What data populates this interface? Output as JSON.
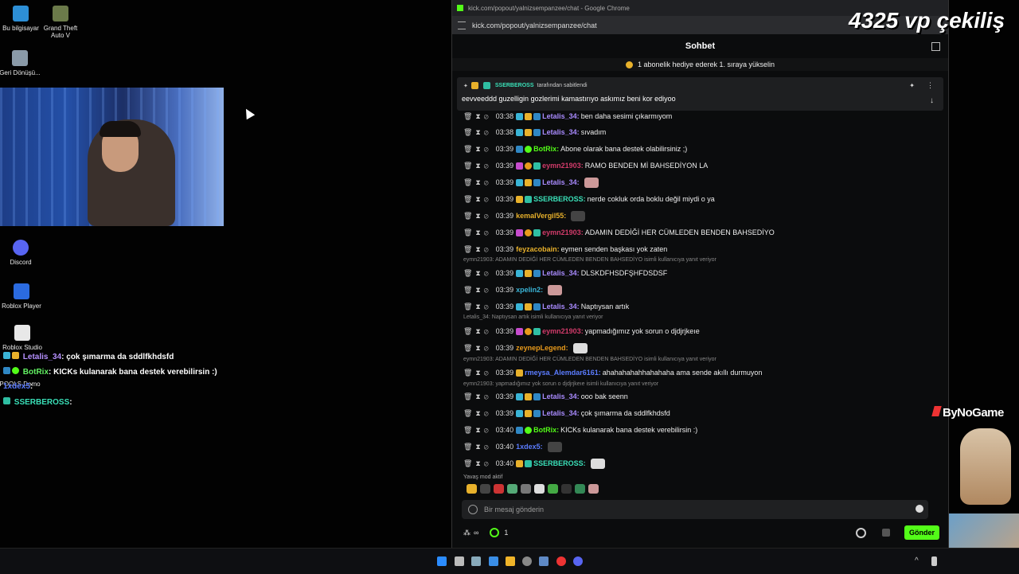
{
  "desktop": {
    "icons": [
      {
        "label": "Bu bilgisayar"
      },
      {
        "label": "Grand Theft Auto V"
      },
      {
        "label": "Geri Dönüşü..."
      },
      {
        "label": "Discord"
      },
      {
        "label": "Roblox Player"
      },
      {
        "label": "Roblox Studio"
      },
      {
        "label": "POOLS Demo"
      }
    ],
    "overlay_chat": [
      {
        "user": "Letalis_34",
        "text": ": çok şımarma da sddlfkhdsfd"
      },
      {
        "user": "BotRix",
        "text": ": KICKs kulanarak bana destek verebilirsin :)"
      },
      {
        "user": "1xdex5",
        "text": ":"
      },
      {
        "user": "SSERBEROSS",
        "text": ":"
      }
    ]
  },
  "browser": {
    "title": "kick.com/popout/yalnizsempanzee/chat - Google Chrome",
    "url": "kick.com/popout/yalnizsempanzee/chat"
  },
  "chat": {
    "header": "Sohbet",
    "banner": "1 abonelik hediye ederek 1. sıraya yükselin",
    "pinned": {
      "by_user": "SSERBEROSS",
      "by_suffix": "tarafından sabitlendi",
      "text": "eevveeddd guzelligin gozlerimi kamastırıyo askımız beni kor ediyoo"
    },
    "messages": [
      {
        "time": "03:38",
        "user": "Letalis_34",
        "text": "ben daha sesimi çıkarmıyom",
        "color": "#a98bff"
      },
      {
        "time": "03:38",
        "user": "Letalis_34",
        "text": "sıvadım",
        "color": "#a98bff"
      },
      {
        "time": "03:39",
        "user": "BotRix",
        "text": "Abone olarak bana destek olabilirsiniz ;)",
        "color": "#53fc18"
      },
      {
        "time": "03:39",
        "user": "eymn21903",
        "text": "RAMO BENDEN Mİ BAHSEDİYON LA",
        "color": "#d13b6a"
      },
      {
        "time": "03:39",
        "user": "Letalis_34",
        "text": "",
        "color": "#a98bff"
      },
      {
        "time": "03:39",
        "user": "SSERBEROSS",
        "text": "nerde cokluk orda boklu değil miydi o ya",
        "color": "#3ae0b8"
      },
      {
        "time": "03:39",
        "user": "kemalVergil55",
        "text": "",
        "color": "#e8b12b"
      },
      {
        "time": "03:39",
        "user": "eymn21903",
        "text": "ADAMIN DEDİĞİ HER CÜMLEDEN BENDEN BAHSEDİYO",
        "color": "#d13b6a"
      },
      {
        "time": "03:39",
        "user": "feyzacobain",
        "text": "eymen senden başkası yok zaten",
        "color": "#e8b12b"
      },
      {
        "time": "03:39",
        "user": "Letalis_34",
        "text": "DLSKDFHSDFŞHFDSDSF",
        "color": "#a98bff"
      },
      {
        "time": "03:39",
        "user": "xpelin2",
        "text": "",
        "color": "#3ab4d6"
      },
      {
        "time": "03:39",
        "user": "Letalis_34",
        "text": "Naptıysan artık",
        "color": "#a98bff"
      },
      {
        "time": "03:39",
        "user": "eymn21903",
        "text": "yapmadığımız yok sorun o djdjrjkeıe",
        "color": "#d13b6a"
      },
      {
        "time": "03:39",
        "user": "zeynepLegend",
        "text": "",
        "color": "#e89a1b"
      },
      {
        "time": "03:39",
        "user": "rmeysa_Alemdar6161",
        "text": "ahahahahahhahahaha ama sende akıllı durmuyon",
        "color": "#5b7cff"
      },
      {
        "time": "03:39",
        "user": "Letalis_34",
        "text": "ooo bak seenn",
        "color": "#a98bff"
      },
      {
        "time": "03:39",
        "user": "Letalis_34",
        "text": "çok şımarma da sddlfkhdsfd",
        "color": "#a98bff"
      },
      {
        "time": "03:40",
        "user": "BotRix",
        "text": "KICKs kulanarak bana destek verebilirsin :)",
        "color": "#53fc18"
      },
      {
        "time": "03:40",
        "user": "1xdex5",
        "text": "",
        "color": "#5b7cff"
      },
      {
        "time": "03:40",
        "user": "SSERBEROSS",
        "text": "",
        "color": "#3ae0b8"
      }
    ],
    "replies": [
      "eymn21903: ADAMIN DEDİĞİ HER CÜMLEDEN BENDEN BAHSEDİYO isimli kullanıcıya yanıt veriyor",
      "Letalis_34: Naptıysan artık isimli kullanıcıya yanıt veriyor",
      "eymn21903: ADAMIN DEDİĞİ HER CÜMLEDEN BENDEN BAHSEDİYO isimli kullanıcıya yanıt veriyor",
      "eymn21903: yapmadığımız yok sorun o djdjrjkeıe isimli kullanıcıya yanıt veriyor"
    ],
    "slow_mode": "Yavaş mod aktif",
    "input_placeholder": "Bir mesaj gönderin",
    "footer": {
      "infinity": "∞",
      "points": "1",
      "send_label": "Gönder"
    }
  },
  "stream_overlay": {
    "headline": "4325 vp çekiliş",
    "brand": "ByNoGame"
  },
  "colors": {
    "kick_green": "#53fc18",
    "background": "#0b0c0d"
  }
}
